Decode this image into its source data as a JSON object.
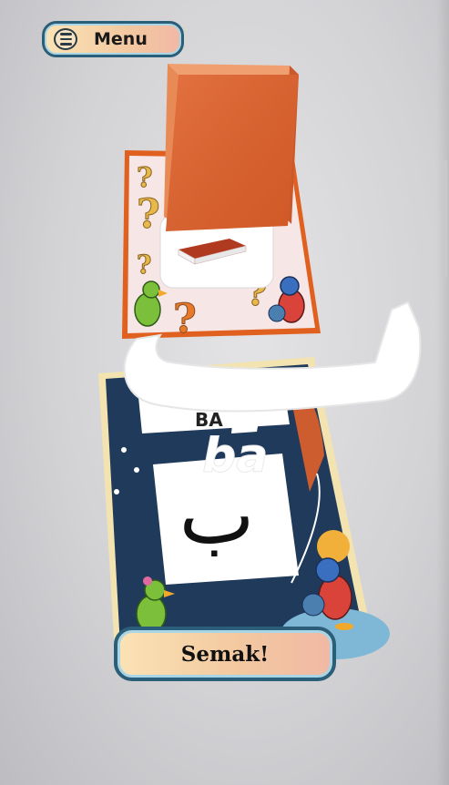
{
  "menu": {
    "label": "Menu"
  },
  "check_button": {
    "label": "Semak!"
  },
  "ar_scene": {
    "letter_arabic": "ب",
    "letter_latin": "ba",
    "card_header_partial": "BA"
  },
  "colors": {
    "button_border": "#2b5e78",
    "button_fill": "#f3c9a0",
    "book_orange": "#e06a2e",
    "card_navy": "#1f3a5a"
  }
}
